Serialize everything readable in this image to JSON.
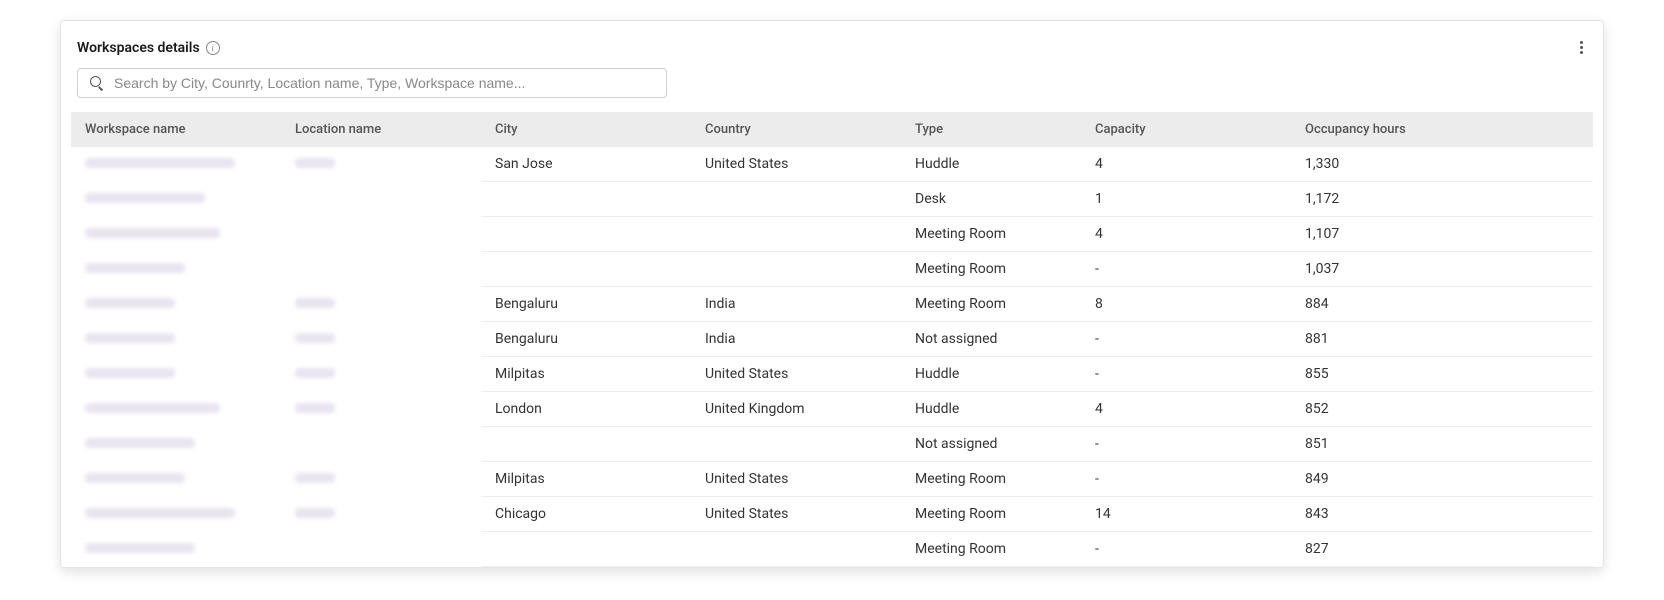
{
  "header": {
    "title": "Workspaces details"
  },
  "search": {
    "placeholder": "Search by City, Counrty, Location name, Type, Workspace name..."
  },
  "table": {
    "columns": [
      "Workspace name",
      "Location name",
      "City",
      "Country",
      "Type",
      "Capacity",
      "Occupancy hours"
    ],
    "rows": [
      {
        "city": "San Jose",
        "country": "United States",
        "type": "Huddle",
        "capacity": "4",
        "occupancy": "1,330"
      },
      {
        "city": "",
        "country": "",
        "type": "Desk",
        "capacity": "1",
        "occupancy": "1,172"
      },
      {
        "city": "",
        "country": "",
        "type": "Meeting Room",
        "capacity": "4",
        "occupancy": "1,107"
      },
      {
        "city": "",
        "country": "",
        "type": "Meeting Room",
        "capacity": "-",
        "occupancy": "1,037"
      },
      {
        "city": "Bengaluru",
        "country": "India",
        "type": "Meeting Room",
        "capacity": "8",
        "occupancy": "884"
      },
      {
        "city": "Bengaluru",
        "country": "India",
        "type": "Not assigned",
        "capacity": "-",
        "occupancy": "881"
      },
      {
        "city": "Milpitas",
        "country": "United States",
        "type": "Huddle",
        "capacity": "-",
        "occupancy": "855"
      },
      {
        "city": "London",
        "country": "United Kingdom",
        "type": "Huddle",
        "capacity": "4",
        "occupancy": "852"
      },
      {
        "city": "",
        "country": "",
        "type": "Not assigned",
        "capacity": "-",
        "occupancy": "851"
      },
      {
        "city": "Milpitas",
        "country": "United States",
        "type": "Meeting Room",
        "capacity": "-",
        "occupancy": "849"
      },
      {
        "city": "Chicago",
        "country": "United States",
        "type": "Meeting Room",
        "capacity": "14",
        "occupancy": "843"
      },
      {
        "city": "",
        "country": "",
        "type": "Meeting Room",
        "capacity": "-",
        "occupancy": "827"
      }
    ]
  }
}
